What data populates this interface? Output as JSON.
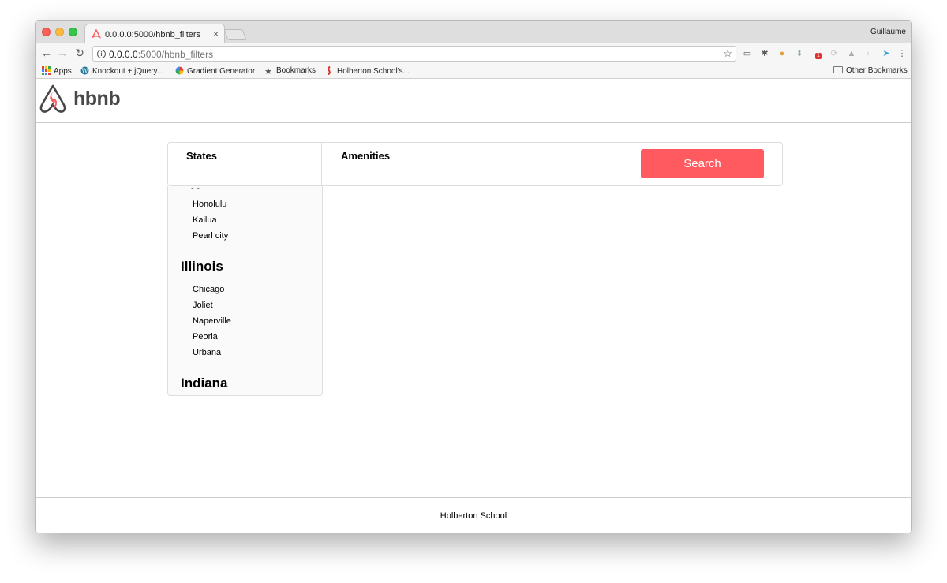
{
  "browser": {
    "tab_title": "0.0.0.0:5000/hbnb_filters",
    "tab_close": "×",
    "profile_name": "Guillaume",
    "url_host": "0.0.0.0",
    "url_rest": ":5000/hbnb_filters",
    "bookmarks": [
      {
        "label": "Apps",
        "icon": "apps-grid-icon"
      },
      {
        "label": "Knockout + jQuery...",
        "icon": "wordpress-icon"
      },
      {
        "label": "Gradient Generator",
        "icon": "gradient-circle-icon"
      },
      {
        "label": "Bookmarks",
        "icon": "star-icon"
      },
      {
        "label": "Holberton School's...",
        "icon": "holberton-icon"
      }
    ],
    "other_bookmarks": "Other Bookmarks",
    "extension_badge": "1"
  },
  "site": {
    "logo_text": "hbnb",
    "brand_color": "#ff5a5f",
    "footer": "Holberton School"
  },
  "filters": {
    "locations_title": "States",
    "amenities_title": "Amenities",
    "search_label": "Search",
    "popover": {
      "states": [
        {
          "name": "",
          "cities": [
            "Honolulu",
            "Kailua",
            "Pearl city"
          ]
        },
        {
          "name": "Illinois",
          "cities": [
            "Chicago",
            "Joliet",
            "Naperville",
            "Peoria",
            "Urbana"
          ]
        },
        {
          "name": "Indiana",
          "cities": []
        }
      ]
    }
  }
}
